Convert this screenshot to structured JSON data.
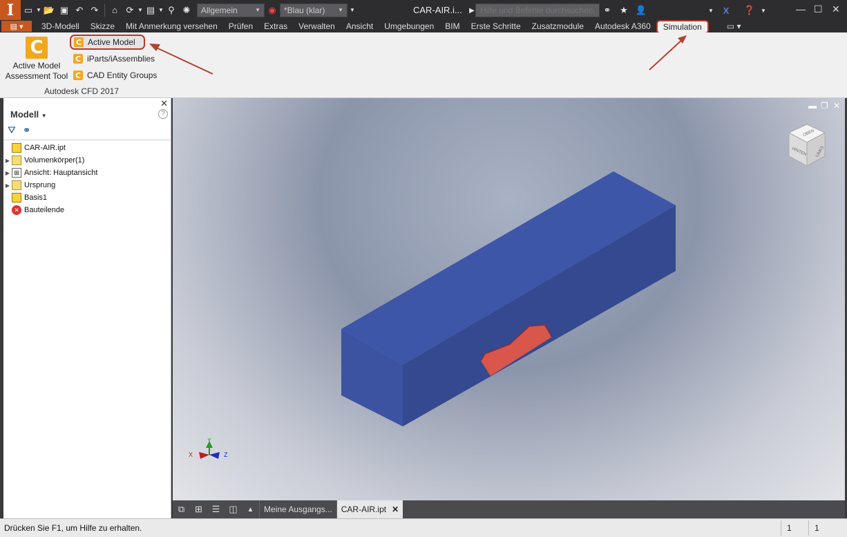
{
  "qat": {
    "style_dropdown": "Allgemein",
    "material_dropdown": "*Blau (klar)",
    "title": "CAR-AIR.i...",
    "search_placeholder": "Hilfe und Befehle durchsuchen..."
  },
  "menu": {
    "file": "",
    "tabs": [
      "3D-Modell",
      "Skizze",
      "Mit Anmerkung versehen",
      "Prüfen",
      "Extras",
      "Verwalten",
      "Ansicht",
      "Umgebungen",
      "BIM",
      "Erste Schritte",
      "Zusatzmodule",
      "Autodesk A360",
      "Simulation"
    ],
    "active_tab": "Simulation"
  },
  "ribbon": {
    "big_button": "Active Model Assessment Tool",
    "small_buttons": [
      "Active Model",
      "iParts/iAssemblies",
      "CAD Entity Groups"
    ],
    "panel_title": "Autodesk CFD 2017"
  },
  "browser": {
    "title": "Modell",
    "help": "?",
    "tree": [
      {
        "label": "CAR-AIR.ipt",
        "icon": "part-icon",
        "expander": ""
      },
      {
        "label": "Volumenkörper(1)",
        "icon": "solid-bodies-icon",
        "expander": "▶"
      },
      {
        "label": "Ansicht: Hauptansicht",
        "icon": "view-rep-icon",
        "expander": "▶"
      },
      {
        "label": "Ursprung",
        "icon": "folder-icon",
        "expander": "▶"
      },
      {
        "label": "Basis1",
        "icon": "extrusion-icon",
        "expander": ""
      },
      {
        "label": "Bauteilende",
        "icon": "end-of-part-icon",
        "expander": ""
      }
    ]
  },
  "viewport": {
    "viewcube_labels": [
      "OBEN",
      "HINTEN",
      "LINKS"
    ],
    "axis_labels": [
      "X",
      "Y",
      "Z"
    ],
    "box_color": "#3f5aa8",
    "car_color": "#d8564a"
  },
  "doc_tabs": {
    "tabs": [
      "Meine Ausgangs...",
      "CAR-AIR.ipt"
    ],
    "active": "CAR-AIR.ipt"
  },
  "status": {
    "text": "Drücken Sie F1, um Hilfe zu erhalten.",
    "cell1": "1",
    "cell2": "1"
  },
  "colors": {
    "accent": "#c8561f",
    "highlight": "#b53a2a",
    "annotation_arrow": "#b0442f"
  }
}
